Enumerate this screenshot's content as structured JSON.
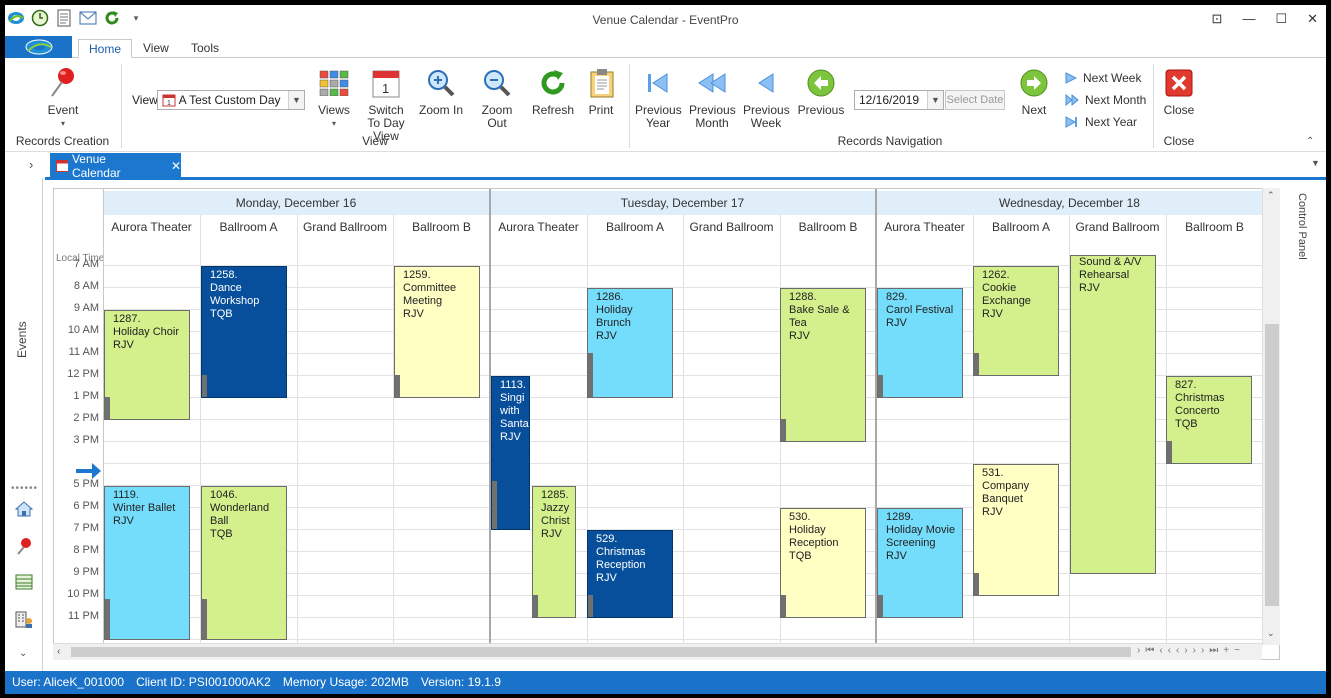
{
  "window": {
    "title": "Venue Calendar - EventPro"
  },
  "ribbon_tabs": [
    "Home",
    "View",
    "Tools"
  ],
  "ribbon": {
    "event_label": "Event",
    "records_creation_label": "Records Creation",
    "view_label": "View",
    "view_value": "A Test Custom Day",
    "views_label": "Views",
    "switch_label": "Switch To Day View",
    "zoom_in_label": "Zoom In",
    "zoom_out_label": "Zoom Out",
    "refresh_label": "Refresh",
    "print_label": "Print",
    "view_group_label": "View",
    "prev_year_label": "Previous Year",
    "prev_month_label": "Previous Month",
    "prev_week_label": "Previous Week",
    "previous_label": "Previous",
    "date_value": "12/16/2019",
    "select_date_label": "Select Date",
    "next_label": "Next",
    "next_week_label": "Next Week",
    "next_month_label": "Next Month",
    "next_year_label": "Next Year",
    "records_nav_label": "Records Navigation",
    "close_label": "Close",
    "close_group_label": "Close"
  },
  "doc_tab": {
    "label": "Venue Calendar"
  },
  "left_panel": {
    "events_label": "Events"
  },
  "control_panel_label": "Control Panel",
  "scheduler": {
    "local_time_label": "Local Time",
    "days": [
      {
        "label": "Monday, December 16"
      },
      {
        "label": "Tuesday, December 17"
      },
      {
        "label": "Wednesday, December 18"
      }
    ],
    "resources": [
      "Aurora Theater",
      "Ballroom A",
      "Grand Ballroom",
      "Ballroom B"
    ],
    "times": [
      "7 AM",
      "8 AM",
      "9 AM",
      "10 AM",
      "11 AM",
      "12 PM",
      "1 PM",
      "2 PM",
      "3 PM",
      "",
      "5 PM",
      "6 PM",
      "7 PM",
      "8 PM",
      "9 PM",
      "10 PM",
      "11 PM"
    ],
    "appointments": [
      {
        "text": "1287.\nHoliday Choir\nRJV",
        "color": "green"
      },
      {
        "text": "1258.\nDance\nWorkshop\nTQB",
        "color": "navy"
      },
      {
        "text": "1259.\nCommittee\nMeeting\nRJV",
        "color": "yellow"
      },
      {
        "text": "1119.\nWinter Ballet\nRJV",
        "color": "blue"
      },
      {
        "text": "1046.\nWonderland\nBall\nTQB",
        "color": "green"
      },
      {
        "text": "1113.\nSingi\nwith\nSanta\nRJV",
        "color": "navy"
      },
      {
        "text": "1286.\nHoliday\nBrunch\nRJV",
        "color": "blue"
      },
      {
        "text": "1288.\nBake Sale &\nTea\nRJV",
        "color": "green"
      },
      {
        "text": "1285.\nJazzy\nChrist\nRJV",
        "color": "green"
      },
      {
        "text": "529.\nChristmas\nReception\nRJV",
        "color": "navy"
      },
      {
        "text": "530.\nHoliday\nReception\nTQB",
        "color": "yellow"
      },
      {
        "text": "829.\nCarol Festival\nRJV",
        "color": "blue"
      },
      {
        "text": "1262.\nCookie\nExchange\nRJV",
        "color": "green"
      },
      {
        "text": "Sound & A/V\nRehearsal\nRJV",
        "color": "green"
      },
      {
        "text": "827.\nChristmas\nConcerto\nTQB",
        "color": "green"
      },
      {
        "text": "531.\nCompany\nBanquet\nRJV",
        "color": "yellow"
      },
      {
        "text": "1289.\nHoliday Movie\nScreening\nRJV",
        "color": "blue"
      }
    ]
  },
  "status": {
    "user": "User: AliceK_001000",
    "client": "Client ID: PSI001000AK2",
    "memory": "Memory Usage: 202MB",
    "version": "Version: 19.1.9"
  }
}
